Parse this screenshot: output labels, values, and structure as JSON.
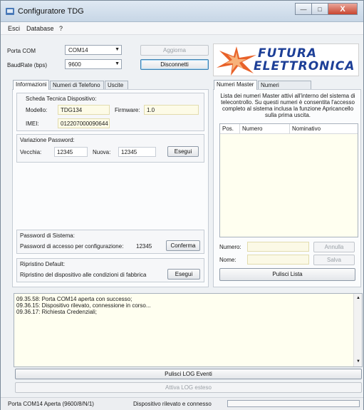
{
  "window": {
    "title": "Configuratore TDG",
    "min_glyph": "—",
    "max_glyph": "□",
    "close_glyph": "X"
  },
  "menu": [
    "Esci",
    "Database",
    "?"
  ],
  "connection": {
    "port_label": "Porta COM",
    "port_value": "COM14",
    "baud_label": "BaudRate (bps)",
    "baud_value": "9600",
    "update_button": "Aggiorna",
    "disconnect_button": "Disconnetti"
  },
  "logo": {
    "line1": "FUTURA",
    "line2": "ELETTRONICA"
  },
  "left_tabs": [
    "Informazioni",
    "Numeri di Telefono",
    "Uscite"
  ],
  "info": {
    "group_title": "Scheda Tecnica Dispositivo:",
    "model_label": "Modello:",
    "model_value": "TDG134",
    "firmware_label": "Firmware:",
    "firmware_value": "1.0",
    "imei_label": "IMEI:",
    "imei_value": "012207000090644"
  },
  "password_change": {
    "title": "Variazione Password:",
    "old_label": "Vecchia:",
    "old_value": "12345",
    "new_label": "Nuova:",
    "new_value": "12345",
    "execute_button": "Esegui"
  },
  "system_password": {
    "title": "Password di Sistema:",
    "label": "Password di accesso per configurazione:",
    "value": "12345",
    "confirm_button": "Conferma"
  },
  "restore": {
    "title": "Ripristino Default:",
    "label": "Ripristino del dispositivo alle condizioni di fabbrica",
    "execute_button": "Esegui"
  },
  "right_tabs": [
    "Numeri Master",
    "Numeri Apricancello"
  ],
  "master": {
    "description": "Lista dei numeri Master attivi all'interno del sistema di telecontrollo. Su questi numeri è consentita l'accesso completo al sistema inclusa la funzione Apricancello sulla prima uscita.",
    "columns": [
      "Pos.",
      "Numero",
      "Nominativo"
    ],
    "numero_label": "Numero:",
    "nome_label": "Nome:",
    "cancel_button": "Annulla",
    "save_button": "Salva",
    "clear_button": "Pulisci Lista"
  },
  "log": {
    "lines": [
      "09.35.58: Porta COM14 aperta con successo;",
      "09.36.15: Dispositivo rilevato, connessione in corso...",
      "09.36.17: Richiesta Credenziali;"
    ],
    "clear_button": "Pulisci LOG Eventi",
    "extended_button": "Attiva LOG esteso"
  },
  "status": {
    "port": "Porta COM14 Aperta (9600/8/N/1)",
    "device": "Dispositivo rilevato e connesso",
    "progress": 0
  },
  "colors": {
    "logo_blue": "#1d3f97",
    "star_orange": "#e8622a",
    "progress_green": "#3fb24a"
  }
}
